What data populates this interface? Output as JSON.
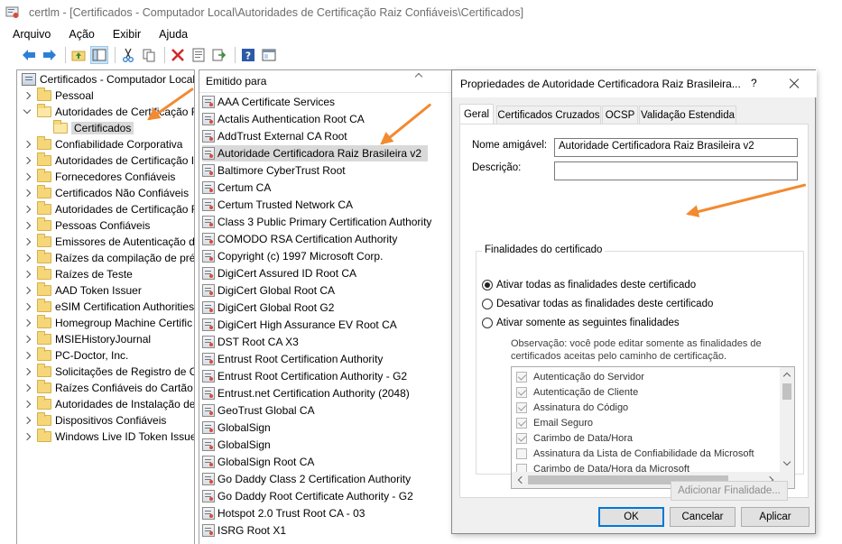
{
  "window": {
    "title": "certlm - [Certificados - Computador Local\\Autoridades de Certificação Raiz Confiáveis\\Certificados]"
  },
  "menu": [
    "Arquivo",
    "Ação",
    "Exibir",
    "Ajuda"
  ],
  "toolbar": {
    "buttons": [
      "back-icon",
      "forward-icon",
      "up-folder-icon",
      "show-tree-icon",
      "cut-icon",
      "copy-icon",
      "delete-icon",
      "properties-icon",
      "export-icon",
      "help-icon",
      "console-icon"
    ]
  },
  "tree": {
    "root": "Certificados - Computador Local",
    "items": [
      {
        "label": "Pessoal",
        "expanded": false
      },
      {
        "label": "Autoridades de Certificação R",
        "expanded": true
      },
      {
        "label": "Certificados",
        "child": true,
        "selected": true
      },
      {
        "label": "Confiabilidade Corporativa",
        "expanded": false
      },
      {
        "label": "Autoridades de Certificação I",
        "expanded": false
      },
      {
        "label": "Fornecedores Confiáveis",
        "expanded": false
      },
      {
        "label": "Certificados Não Confiáveis",
        "expanded": false
      },
      {
        "label": "Autoridades de Certificação F",
        "expanded": false
      },
      {
        "label": "Pessoas Confiáveis",
        "expanded": false
      },
      {
        "label": "Emissores de Autenticação d",
        "expanded": false
      },
      {
        "label": "Raízes da compilação de pré-",
        "expanded": false
      },
      {
        "label": "Raízes de Teste",
        "expanded": false
      },
      {
        "label": "AAD Token Issuer",
        "expanded": false
      },
      {
        "label": "eSIM Certification Authorities",
        "expanded": false
      },
      {
        "label": "Homegroup Machine Certific",
        "expanded": false
      },
      {
        "label": "MSIEHistoryJournal",
        "expanded": false
      },
      {
        "label": "PC-Doctor, Inc.",
        "expanded": false
      },
      {
        "label": "Solicitações de Registro de Ce",
        "expanded": false
      },
      {
        "label": "Raízes Confiáveis do Cartão I",
        "expanded": false
      },
      {
        "label": "Autoridades de Instalação de",
        "expanded": false
      },
      {
        "label": "Dispositivos Confiáveis",
        "expanded": false
      },
      {
        "label": "Windows Live ID Token Issuer",
        "expanded": false
      }
    ]
  },
  "list": {
    "column_header": "Emitido para",
    "items": [
      "AAA Certificate Services",
      "Actalis Authentication Root CA",
      "AddTrust External CA Root",
      "Autoridade Certificadora Raiz Brasileira v2",
      "Baltimore CyberTrust Root",
      "Certum CA",
      "Certum Trusted Network CA",
      "Class 3 Public Primary Certification Authority",
      "COMODO RSA Certification Authority",
      "Copyright (c) 1997 Microsoft Corp.",
      "DigiCert Assured ID Root CA",
      "DigiCert Global Root CA",
      "DigiCert Global Root G2",
      "DigiCert High Assurance EV Root CA",
      "DST Root CA X3",
      "Entrust Root Certification Authority",
      "Entrust Root Certification Authority - G2",
      "Entrust.net Certification Authority (2048)",
      "GeoTrust Global CA",
      "GlobalSign",
      "GlobalSign",
      "GlobalSign Root CA",
      "Go Daddy Class 2 Certification Authority",
      "Go Daddy Root Certificate Authority - G2",
      "Hotspot 2.0 Trust Root CA - 03",
      "ISRG Root X1"
    ],
    "selected_index": 3
  },
  "dialog": {
    "title": "Propriedades de Autoridade Certificadora Raiz Brasileira...",
    "help": "?",
    "tabs": [
      "Geral",
      "Certificados Cruzados",
      "OCSP",
      "Validação Estendida"
    ],
    "active_tab": 0,
    "friendly_name_label": "Nome amigável:",
    "friendly_name_value": "Autoridade Certificadora Raiz Brasileira v2",
    "description_label": "Descrição:",
    "description_value": "",
    "group_title": "Finalidades do certificado",
    "radio_options": [
      "Ativar todas as finalidades deste certificado",
      "Desativar todas as finalidades deste certificado",
      "Ativar somente as seguintes finalidades"
    ],
    "radio_selected": 0,
    "note": "Observação: você pode editar somente as finalidades de certificados aceitas pelo caminho de certificação.",
    "purposes": [
      {
        "label": "Autenticação do Servidor",
        "checked": true
      },
      {
        "label": "Autenticação de Cliente",
        "checked": true
      },
      {
        "label": "Assinatura do Código",
        "checked": true
      },
      {
        "label": "Email Seguro",
        "checked": true
      },
      {
        "label": "Carimbo de Data/Hora",
        "checked": true
      },
      {
        "label": "Assinatura da Lista de Confiabilidade da Microsoft",
        "checked": false
      },
      {
        "label": "Carimbo de Data/Hora da Microsoft",
        "checked": false
      }
    ],
    "add_purpose_button": "Adicionar Finalidade...",
    "ok_button": "OK",
    "cancel_button": "Cancelar",
    "apply_button": "Aplicar"
  },
  "colors": {
    "annotation_arrow": "#f28a30",
    "selection": "#d9d9d9",
    "accent": "#0078d7"
  }
}
